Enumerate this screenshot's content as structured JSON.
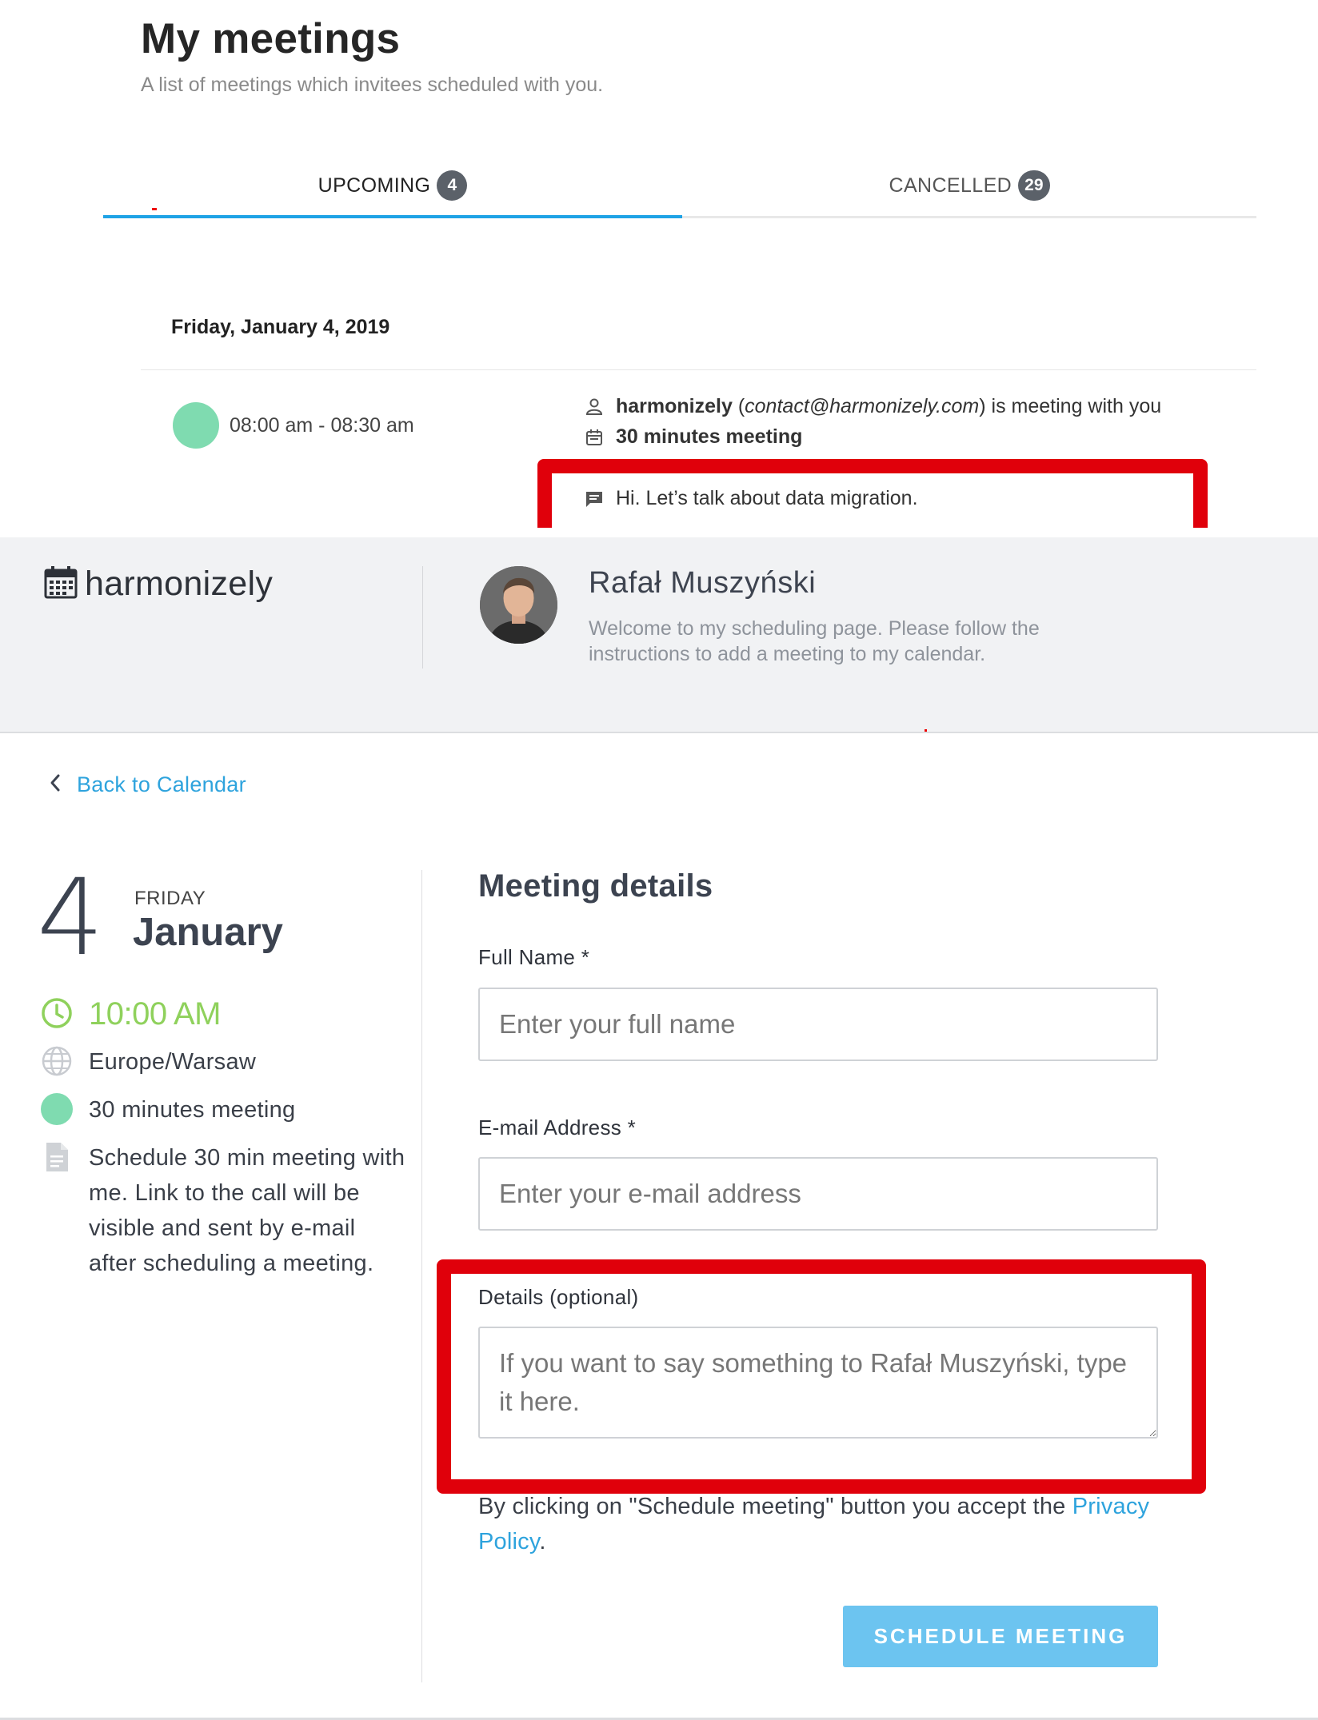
{
  "meetings_page": {
    "title": "My meetings",
    "subtitle": "A list of meetings which invitees scheduled with you.",
    "tabs": [
      {
        "label": "UPCOMING",
        "count": "4",
        "active": true
      },
      {
        "label": "CANCELLED",
        "count": "29",
        "active": false
      }
    ],
    "date_heading": "Friday, January 4, 2019",
    "meeting": {
      "time_range": "08:00 am - 08:30 am",
      "dot_color": "#7fdbb0",
      "invitee_name": "harmonizely",
      "invitee_email": "contact@harmonizely.com",
      "meeting_with_text": "is meeting with you",
      "type": "30 minutes meeting",
      "message": "Hi. Let’s talk about data migration.",
      "icons": [
        "person-icon",
        "calendar-icon",
        "comment-icon"
      ]
    }
  },
  "scheduler": {
    "brand": {
      "logo_icon": "calendar-grid-icon",
      "name": "harmonizely"
    },
    "owner": {
      "name": "Rafał Muszyński",
      "welcome": "Welcome to my scheduling page. Please follow the instructions to add a meeting to my calendar."
    },
    "back_link": "Back to Calendar",
    "summary": {
      "day_number": "4",
      "weekday": "FRIDAY",
      "month": "January",
      "time": "10:00 AM",
      "timezone": "Europe/Warsaw",
      "meeting_type": "30 minutes meeting",
      "description": "Schedule 30 min meeting with me. Link to the call will be visible and sent by e-mail after scheduling a meeting.",
      "icons": [
        "clock-icon",
        "globe-icon",
        "color-dot-icon",
        "document-icon"
      ]
    },
    "form": {
      "title": "Meeting details",
      "full_name": {
        "label": "Full Name *",
        "placeholder": "Enter your full name",
        "value": ""
      },
      "email": {
        "label": "E-mail Address *",
        "placeholder": "Enter your e-mail address",
        "value": ""
      },
      "details": {
        "label": "Details (optional)",
        "placeholder": "If you want to say something to Rafał Muszyński, type it here.",
        "value": ""
      },
      "consent_text": "By clicking on \"Schedule meeting\" button you accept the",
      "privacy_link": "Privacy Policy",
      "consent_end": ".",
      "submit_label": "SCHEDULE MEETING"
    }
  },
  "colors": {
    "accent_blue": "#1fa3e6",
    "link_blue": "#2ea3dd",
    "button_blue": "#6cc4f0",
    "time_green": "#8fd15c",
    "meeting_dot": "#7fdbb0",
    "highlight_red": "#e0000b"
  }
}
